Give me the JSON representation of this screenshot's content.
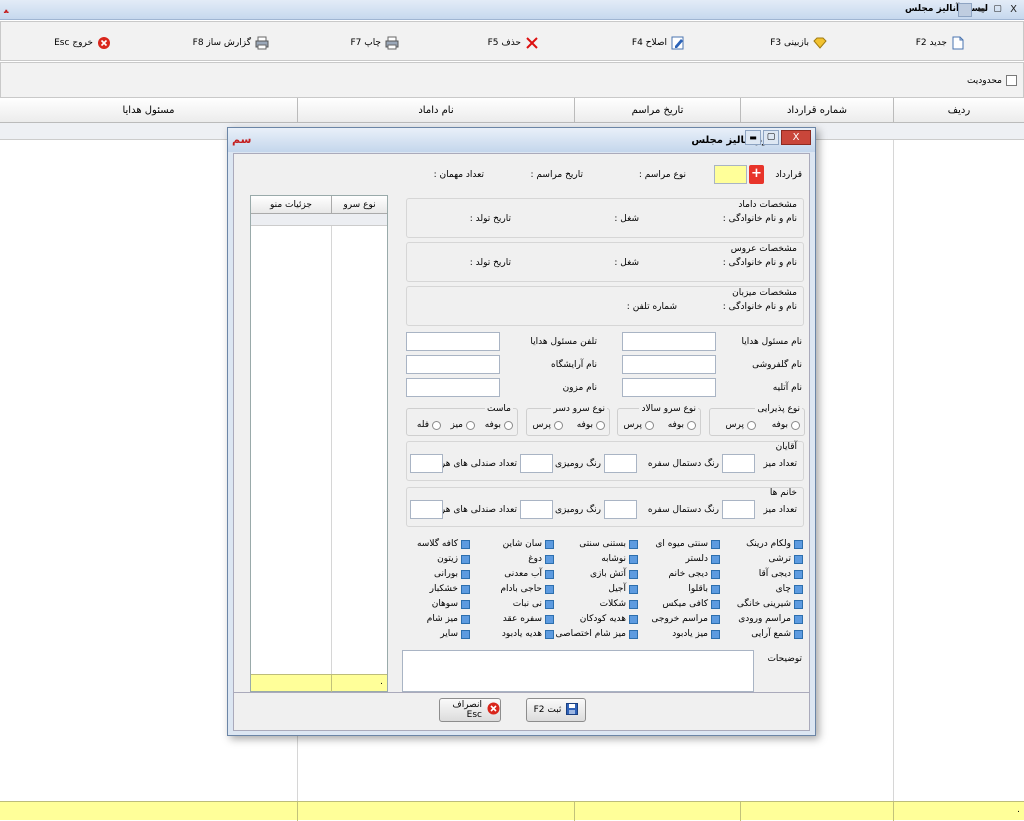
{
  "window": {
    "title": "لیست آنالیز مجلس",
    "close": "X",
    "min": "▬",
    "max": "▢"
  },
  "toolbar": {
    "new": "جدید F2",
    "view": "بازبینی F3",
    "edit": "اصلاح F4",
    "delete": "حذف F5",
    "print": "چاپ F7",
    "report": "گزارش ساز F8",
    "exit": "خروج Esc"
  },
  "filter": {
    "limit_label": "محدودیت"
  },
  "grid": {
    "columns": [
      "ردیف",
      "شماره قرارداد",
      "تاریخ مراسم",
      "نام داماد",
      "مسئول هدایا"
    ],
    "footer_mark": "."
  },
  "modal": {
    "title": "فرم آنالیز مجلس",
    "header": {
      "contract": "قرارداد",
      "ceremony_type": "نوع مراسم :",
      "ceremony_date": "تاریخ مراسم :",
      "guest_count": "تعداد مهمان :"
    },
    "groom": {
      "title": "مشخصات داماد",
      "name": "نام و نام خانوادگی :",
      "job": "شغل :",
      "birth": "تاریخ تولد :"
    },
    "bride": {
      "title": "مشخصات عروس",
      "name": "نام و نام خانوادگی :",
      "job": "شغل :",
      "birth": "تاریخ تولد :"
    },
    "host": {
      "title": "مشخصات میزبان",
      "name": "نام و نام خانوادگی :",
      "phone": "شماره تلفن :"
    },
    "fields": {
      "gifts_name": "نام مسئول هدایا",
      "gifts_phone": "تلفن مسئول هدایا",
      "florist": "نام گلفروشی",
      "salon": "نام آرایشگاه",
      "atelier": "نام آتلیه",
      "musician": "نام مزون"
    },
    "service": {
      "reception": "نوع پذیرایی",
      "salad": "نوع سرو سالاد",
      "dessert": "نوع سرو دسر",
      "yogurt": "ماست",
      "buffet": "بوفه",
      "pers": "پرس",
      "table": "میز",
      "plate": "فله"
    },
    "men": {
      "title": "آقایان",
      "tables": "تعداد میز",
      "napkin": "رنگ دستمال سفره",
      "cloth": "رنگ رومیزی",
      "chairs": "تعداد صندلی های هر میز"
    },
    "women": {
      "title": "خانم ها",
      "tables": "تعداد میز",
      "napkin": "رنگ دستمال سفره",
      "cloth": "رنگ رومیزی",
      "chairs": "تعداد صندلی های هر میز"
    },
    "checks": [
      [
        "ولکام درینک",
        "سنتی میوه ای",
        "بستنی سنتی",
        "سان شاین",
        "کافه گلاسه"
      ],
      [
        "ترشی",
        "دلستر",
        "نوشابه",
        "دوغ",
        "زیتون"
      ],
      [
        "دیجی آقا",
        "دیجی خانم",
        "آتش بازی",
        "آب معدنی",
        "بورانی"
      ],
      [
        "چای",
        "باقلوا",
        "آجیل",
        "حاجی بادام",
        "خشکبار"
      ],
      [
        "شیرینی خانگی",
        "کافی میکس",
        "شکلات",
        "نی نبات",
        "سوهان"
      ],
      [
        "مراسم ورودی",
        "مراسم خروجی",
        "هدیه کودکان",
        "سفره عقد",
        "میز شام"
      ],
      [
        "شمع آرایی",
        "میز یادبود",
        "میز شام اختصاصی",
        "هدیه یادبود",
        "سایر"
      ]
    ],
    "notes": "توضیحات",
    "menu_table": {
      "col1": "نوع سرو",
      "col2": "جزئیات منو",
      "footer_mark": "."
    },
    "buttons": {
      "save": "ثبت F2",
      "cancel": "انصراف Esc"
    },
    "add_symbol": "+",
    "logo": "ﺳﻢ"
  }
}
